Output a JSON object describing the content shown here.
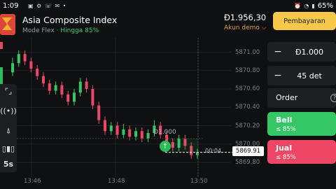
{
  "status_bar": {
    "time": "1:09",
    "icons": [
      "video-icon",
      "settings-icon",
      "phone-icon",
      "message-icon",
      "dot"
    ],
    "battery": "65%"
  },
  "header": {
    "asset_name": "Asia Composite Index",
    "mode": "Mode Flex",
    "separator": "·",
    "payout": "Hingga 85%",
    "balance": "Đ1.956,30",
    "account": "Akun demo",
    "deposit_label": "Pembayaran"
  },
  "chart": {
    "y_ticks": [
      "5871.00",
      "5870.80",
      "5870.60",
      "5870.40",
      "5870.20",
      "5870.00",
      "5869.80"
    ],
    "x_ticks": [
      "13:46",
      "13:48",
      "13:50"
    ],
    "current_price": "5869.91",
    "timer": "00:04",
    "strike_amount": "Đ1.000",
    "colors": {
      "up": "#35c765",
      "down": "#ee4766",
      "background": "#0f1012"
    }
  },
  "chart_data": {
    "type": "candlestick",
    "y_range": [
      5869.8,
      5871.08
    ],
    "candles": [
      {
        "o": 5870.78,
        "c": 5870.88,
        "h": 5870.94,
        "l": 5870.74
      },
      {
        "o": 5870.88,
        "c": 5870.98,
        "h": 5871.02,
        "l": 5870.84
      },
      {
        "o": 5870.98,
        "c": 5870.9,
        "h": 5871.02,
        "l": 5870.86
      },
      {
        "o": 5870.9,
        "c": 5870.82,
        "h": 5870.94,
        "l": 5870.78
      },
      {
        "o": 5870.82,
        "c": 5870.74,
        "h": 5870.86,
        "l": 5870.7
      },
      {
        "o": 5870.74,
        "c": 5870.66,
        "h": 5870.78,
        "l": 5870.62
      },
      {
        "o": 5870.66,
        "c": 5870.58,
        "h": 5870.7,
        "l": 5870.54
      },
      {
        "o": 5870.58,
        "c": 5870.64,
        "h": 5870.68,
        "l": 5870.54
      },
      {
        "o": 5870.64,
        "c": 5870.54,
        "h": 5870.68,
        "l": 5870.5
      },
      {
        "o": 5870.54,
        "c": 5870.46,
        "h": 5870.58,
        "l": 5870.42
      },
      {
        "o": 5870.46,
        "c": 5870.56,
        "h": 5870.6,
        "l": 5870.42
      },
      {
        "o": 5870.56,
        "c": 5870.68,
        "h": 5870.72,
        "l": 5870.52
      },
      {
        "o": 5870.68,
        "c": 5870.6,
        "h": 5870.72,
        "l": 5870.56
      },
      {
        "o": 5870.6,
        "c": 5870.42,
        "h": 5870.64,
        "l": 5870.38
      },
      {
        "o": 5870.42,
        "c": 5870.26,
        "h": 5870.46,
        "l": 5870.22
      },
      {
        "o": 5870.26,
        "c": 5870.14,
        "h": 5870.3,
        "l": 5870.1
      },
      {
        "o": 5870.14,
        "c": 5870.2,
        "h": 5870.24,
        "l": 5870.1
      },
      {
        "o": 5870.2,
        "c": 5870.1,
        "h": 5870.24,
        "l": 5870.06
      },
      {
        "o": 5870.1,
        "c": 5870.16,
        "h": 5870.22,
        "l": 5870.06
      },
      {
        "o": 5870.16,
        "c": 5870.08,
        "h": 5870.2,
        "l": 5870.04
      },
      {
        "o": 5870.08,
        "c": 5870.14,
        "h": 5870.18,
        "l": 5870.04
      },
      {
        "o": 5870.14,
        "c": 5870.06,
        "h": 5870.18,
        "l": 5870.02
      },
      {
        "o": 5870.06,
        "c": 5870.12,
        "h": 5870.16,
        "l": 5870.02
      },
      {
        "o": 5870.12,
        "c": 5870.2,
        "h": 5870.26,
        "l": 5870.08
      },
      {
        "o": 5870.2,
        "c": 5870.1,
        "h": 5870.24,
        "l": 5870.06
      },
      {
        "o": 5870.1,
        "c": 5870.02,
        "h": 5870.14,
        "l": 5869.98
      },
      {
        "o": 5870.02,
        "c": 5869.96,
        "h": 5870.06,
        "l": 5869.92
      },
      {
        "o": 5869.96,
        "c": 5870.06,
        "h": 5870.1,
        "l": 5869.92
      },
      {
        "o": 5870.06,
        "c": 5869.98,
        "h": 5870.1,
        "l": 5869.94
      },
      {
        "o": 5869.98,
        "c": 5869.88,
        "h": 5870.02,
        "l": 5869.84
      },
      {
        "o": 5869.88,
        "c": 5869.91,
        "h": 5869.95,
        "l": 5869.84
      }
    ]
  },
  "toolbar": {
    "tools": [
      "collapse-icon",
      "signal-icon",
      "drawing-icon",
      "indicators-icon"
    ],
    "timeframe": "5s"
  },
  "trade_panel": {
    "amount": "Đ1.000",
    "duration": "45 det",
    "minus_symbol": "−",
    "order_label": "Order",
    "help_symbol": "?",
    "buy_label": "Beli",
    "buy_payout": "≤ 85%",
    "sell_label": "Jual",
    "sell_payout": "≤ 85%"
  }
}
